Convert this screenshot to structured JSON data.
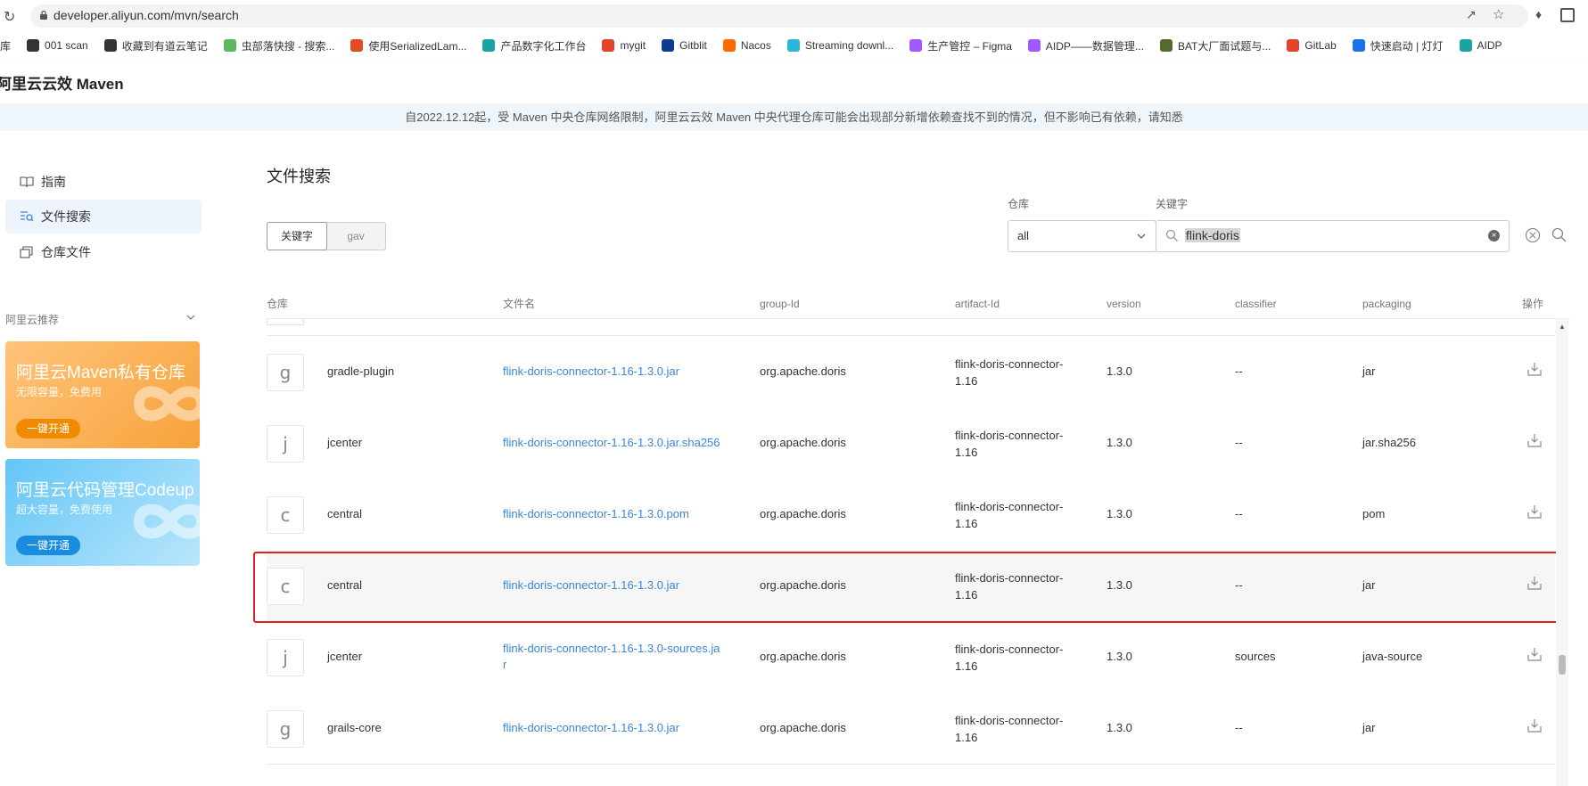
{
  "browser": {
    "url": "developer.aliyun.com/mvn/search",
    "bookmarks": [
      {
        "label": "库",
        "color": "#888"
      },
      {
        "label": "001 scan",
        "color": "#333"
      },
      {
        "label": "收藏到有道云笔记",
        "color": "#333"
      },
      {
        "label": "虫部落快搜 - 搜索...",
        "color": "#5cb85c"
      },
      {
        "label": "使用SerializedLam...",
        "color": "#e34b26"
      },
      {
        "label": "产品数字化工作台",
        "color": "#1aa3a3"
      },
      {
        "label": "mygit",
        "color": "#e24329"
      },
      {
        "label": "Gitblit",
        "color": "#0a3d91"
      },
      {
        "label": "Nacos",
        "color": "#ff6a00"
      },
      {
        "label": "Streaming downl...",
        "color": "#2bb5d8"
      },
      {
        "label": "生产管控 – Figma",
        "color": "#a259ff"
      },
      {
        "label": "AIDP——数据管理...",
        "color": "#a259ff"
      },
      {
        "label": "BAT大厂面试题与...",
        "color": "#556b2f"
      },
      {
        "label": "GitLab",
        "color": "#e24329"
      },
      {
        "label": "快速启动 | 灯灯",
        "color": "#1a73e8"
      },
      {
        "label": "AIDP",
        "color": "#1aa3a3"
      }
    ]
  },
  "app": {
    "title": "阿里云云效 Maven",
    "notice": "自2022.12.12起，受 Maven 中央仓库网络限制，阿里云云效 Maven 中央代理仓库可能会出现部分新增依赖查找不到的情况，但不影响已有依赖，请知悉"
  },
  "sidebar": {
    "items": [
      {
        "label": "指南",
        "icon": "book-icon"
      },
      {
        "label": "文件搜索",
        "icon": "file-search-icon"
      },
      {
        "label": "仓库文件",
        "icon": "repository-icon"
      }
    ],
    "recommend_label": "阿里云推荐",
    "promos": [
      {
        "title": "阿里云Maven私有仓库",
        "subtitle": "无限容量，免费用",
        "button": "一键开通"
      },
      {
        "title": "阿里云代码管理Codeup",
        "subtitle": "超大容量，免费使用",
        "button": "一键开通"
      }
    ]
  },
  "main": {
    "heading": "文件搜索",
    "tabs": [
      "关键字",
      "gav"
    ],
    "repo_label": "仓库",
    "repo_value": "all",
    "keyword_label": "关键字",
    "keyword_value": "flink-doris",
    "columns": [
      "仓库",
      "文件名",
      "group-Id",
      "artifact-Id",
      "version",
      "classifier",
      "packaging",
      "操作"
    ],
    "rows": [
      {
        "letter": "g",
        "repo": "gradle-plugin",
        "file": "flink-doris-connector-1.16-1.3.0.jar",
        "group": "org.apache.doris",
        "artifact_1": "flink-doris-connector-",
        "artifact_2": "1.16",
        "version": "1.3.0",
        "classifier": "--",
        "packaging": "jar"
      },
      {
        "letter": "j",
        "repo": "jcenter",
        "file": "flink-doris-connector-1.16-1.3.0.jar.sha256",
        "group": "org.apache.doris",
        "artifact_1": "flink-doris-connector-",
        "artifact_2": "1.16",
        "version": "1.3.0",
        "classifier": "--",
        "packaging": "jar.sha256"
      },
      {
        "letter": "c",
        "repo": "central",
        "file": "flink-doris-connector-1.16-1.3.0.pom",
        "group": "org.apache.doris",
        "artifact_1": "flink-doris-connector-",
        "artifact_2": "1.16",
        "version": "1.3.0",
        "classifier": "--",
        "packaging": "pom"
      },
      {
        "letter": "c",
        "repo": "central",
        "file": "flink-doris-connector-1.16-1.3.0.jar",
        "group": "org.apache.doris",
        "artifact_1": "flink-doris-connector-",
        "artifact_2": "1.16",
        "version": "1.3.0",
        "classifier": "--",
        "packaging": "jar"
      },
      {
        "letter": "j",
        "repo": "jcenter",
        "file_1": "flink-doris-connector-1.16-1.3.0-sources.ja",
        "file_2": "r",
        "group": "org.apache.doris",
        "artifact_1": "flink-doris-connector-",
        "artifact_2": "1.16",
        "version": "1.3.0",
        "classifier": "sources",
        "packaging": "java-source"
      },
      {
        "letter": "g",
        "repo": "grails-core",
        "file": "flink-doris-connector-1.16-1.3.0.jar",
        "group": "org.apache.doris",
        "artifact_1": "flink-doris-connector-",
        "artifact_2": "1.16",
        "version": "1.3.0",
        "classifier": "--",
        "packaging": "jar"
      }
    ]
  },
  "colors": {
    "highlight_border": "#e02020",
    "link": "#3a86d6",
    "promo1": "#f7a23a",
    "promo2": "#3fb3f0"
  }
}
